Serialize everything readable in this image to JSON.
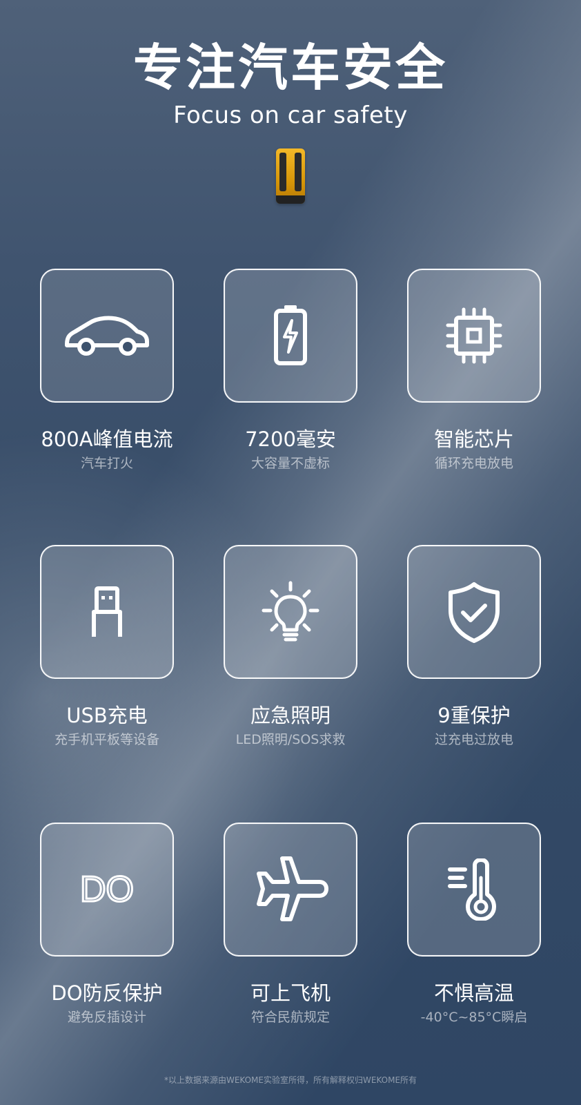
{
  "header": {
    "title": "专注汽车安全",
    "subtitle": "Focus on car safety",
    "product_image": "car-jump-starter-image"
  },
  "features": [
    {
      "icon": "car-icon",
      "label": "800A峰值电流",
      "sub": "汽车打火"
    },
    {
      "icon": "battery-icon",
      "label": "7200毫安",
      "sub": "大容量不虚标"
    },
    {
      "icon": "chip-icon",
      "label": "智能芯片",
      "sub": "循环充电放电"
    },
    {
      "icon": "usb-icon",
      "label": "USB充电",
      "sub": "充手机平板等设备"
    },
    {
      "icon": "light-bulb-icon",
      "label": "应急照明",
      "sub": "LED照明/SOS求救"
    },
    {
      "icon": "shield-check-icon",
      "label": "9重保护",
      "sub": "过充电过放电"
    },
    {
      "icon": "do-connector-icon",
      "label": "DO防反保护",
      "sub": "避免反插设计",
      "icon_text": "DO"
    },
    {
      "icon": "airplane-icon",
      "label": "可上飞机",
      "sub": "符合民航规定"
    },
    {
      "icon": "thermometer-icon",
      "label": "不惧高温",
      "sub": "-40°C~85°C瞬启"
    }
  ],
  "footer": {
    "disclaimer": "*以上数据来源由WEKOME实验室所得，所有解释权归WEKOME所有"
  },
  "colors": {
    "background": "#3b4f69",
    "card_border": "#ffffff",
    "subtext": "#c4ccd6",
    "device_yellow": "#e8aa1a"
  }
}
